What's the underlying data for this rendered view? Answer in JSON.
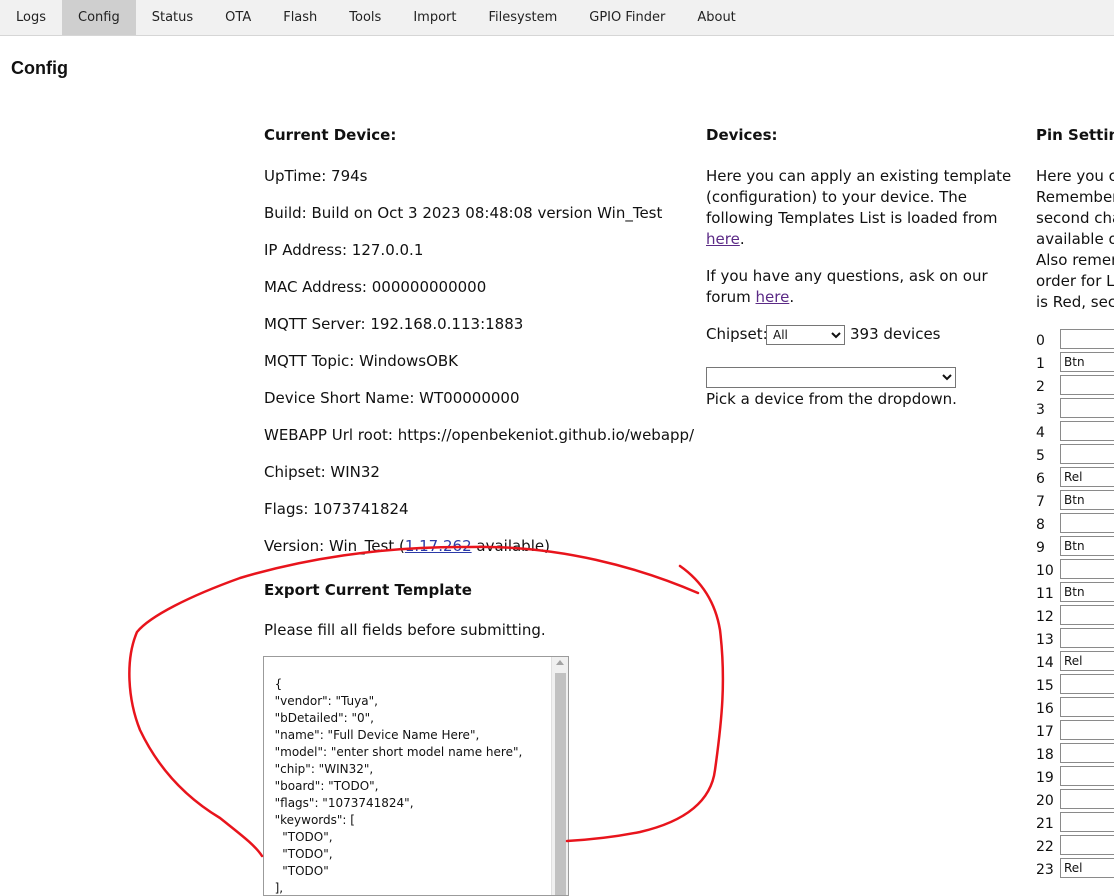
{
  "tabs": [
    {
      "label": "Logs"
    },
    {
      "label": "Config"
    },
    {
      "label": "Status"
    },
    {
      "label": "OTA"
    },
    {
      "label": "Flash"
    },
    {
      "label": "Tools"
    },
    {
      "label": "Import"
    },
    {
      "label": "Filesystem"
    },
    {
      "label": "GPIO Finder"
    },
    {
      "label": "About"
    }
  ],
  "page_title": "Config",
  "current_device": {
    "heading": "Current Device:",
    "uptime": "UpTime: 794s",
    "build": "Build: Build on Oct 3 2023 08:48:08 version Win_Test",
    "ip": "IP Address: 127.0.0.1",
    "mac": "MAC Address: 000000000000",
    "mqtt_server": "MQTT Server: 192.168.0.113:1883",
    "mqtt_topic": "MQTT Topic: WindowsOBK",
    "short_name": "Device Short Name: WT00000000",
    "webapp_root": "WEBAPP Url root: https://openbekeniot.github.io/webapp/",
    "chipset": "Chipset: WIN32",
    "flags": "Flags: 1073741824",
    "version_prefix": "Version: Win_Test (",
    "version_link": "1.17.262",
    "version_suffix": " available)"
  },
  "export": {
    "heading": "Export Current Template",
    "instruction": "Please fill all fields before submitting.",
    "template_text": "{\n  \"vendor\": \"Tuya\",\n  \"bDetailed\": \"0\",\n  \"name\": \"Full Device Name Here\",\n  \"model\": \"enter short model name here\",\n  \"chip\": \"WIN32\",\n  \"board\": \"TODO\",\n  \"flags\": \"1073741824\",\n  \"keywords\": [\n    \"TODO\",\n    \"TODO\",\n    \"TODO\"\n  ],\n  \"pins\": {"
  },
  "devices": {
    "heading": "Devices:",
    "intro_l1": "Here you can apply an existing template",
    "intro_l2": "(configuration) to your device. The",
    "intro_l3": "following Templates List is loaded from",
    "intro_link": "here",
    "intro_end": ".",
    "forum_l1": "If you have any questions, ask on our",
    "forum_prefix": "forum ",
    "forum_link": "here",
    "forum_end": ".",
    "chipset_label": "Chipset:",
    "chipset_selected": "All",
    "device_count": "393 devices",
    "device_select_value": "",
    "pick_hint": "Pick a device from the dropdown."
  },
  "pin_settings": {
    "heading": "Pin Setting",
    "desc": [
      "Here you ca",
      "Remember",
      "second cha",
      "available or",
      "Also remem",
      "order for LE",
      "is Red, seco"
    ],
    "pins": [
      {
        "num": "0",
        "role": ""
      },
      {
        "num": "1",
        "role": "Btn"
      },
      {
        "num": "2",
        "role": ""
      },
      {
        "num": "3",
        "role": ""
      },
      {
        "num": "4",
        "role": ""
      },
      {
        "num": "5",
        "role": ""
      },
      {
        "num": "6",
        "role": "Rel"
      },
      {
        "num": "7",
        "role": "Btn"
      },
      {
        "num": "8",
        "role": ""
      },
      {
        "num": "9",
        "role": "Btn"
      },
      {
        "num": "10",
        "role": ""
      },
      {
        "num": "11",
        "role": "Btn"
      },
      {
        "num": "12",
        "role": ""
      },
      {
        "num": "13",
        "role": ""
      },
      {
        "num": "14",
        "role": "Rel"
      },
      {
        "num": "15",
        "role": ""
      },
      {
        "num": "16",
        "role": ""
      },
      {
        "num": "17",
        "role": ""
      },
      {
        "num": "18",
        "role": ""
      },
      {
        "num": "19",
        "role": ""
      },
      {
        "num": "20",
        "role": ""
      },
      {
        "num": "21",
        "role": ""
      },
      {
        "num": "22",
        "role": ""
      },
      {
        "num": "23",
        "role": "Rel"
      }
    ]
  },
  "colors": {
    "annotation": "#e8141c",
    "link": "#5b2a86",
    "tab_active": "#cfcfcf"
  }
}
